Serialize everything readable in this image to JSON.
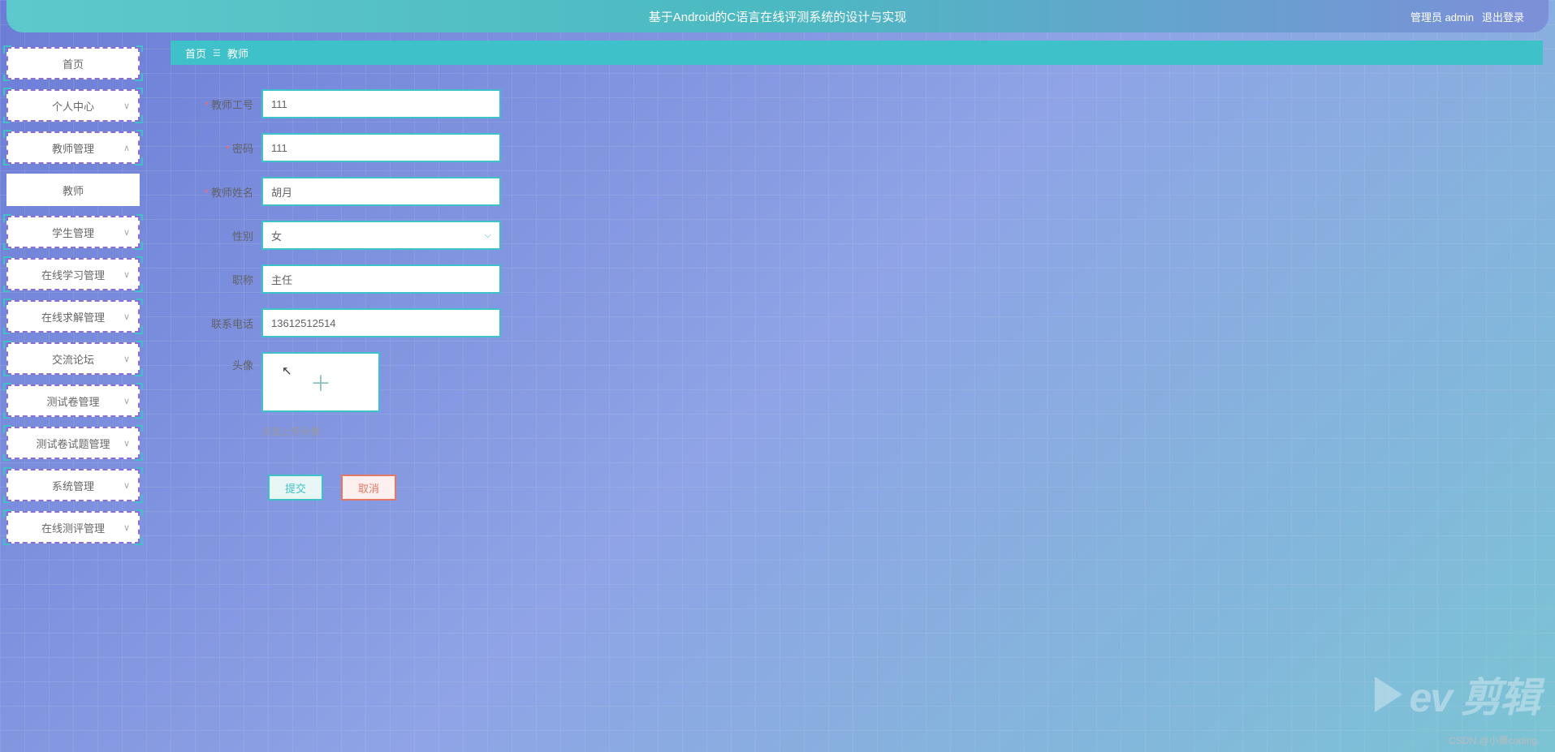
{
  "header": {
    "title": "基于Android的C语言在线评测系统的设计与实现",
    "admin_label": "管理员 admin",
    "logout": "退出登录"
  },
  "sidebar": {
    "items": [
      {
        "label": "首页",
        "arrow": ""
      },
      {
        "label": "个人中心",
        "arrow": "∨"
      },
      {
        "label": "教师管理",
        "arrow": "∧"
      },
      {
        "label": "教师",
        "arrow": "",
        "plain": true
      },
      {
        "label": "学生管理",
        "arrow": "∨"
      },
      {
        "label": "在线学习管理",
        "arrow": "∨"
      },
      {
        "label": "在线求解管理",
        "arrow": "∨"
      },
      {
        "label": "交流论坛",
        "arrow": "∨"
      },
      {
        "label": "测试卷管理",
        "arrow": "∨"
      },
      {
        "label": "测试卷试题管理",
        "arrow": "∨"
      },
      {
        "label": "系统管理",
        "arrow": "∨"
      },
      {
        "label": "在线测评管理",
        "arrow": "∨"
      }
    ]
  },
  "breadcrumb": {
    "home": "首页",
    "current": "教师"
  },
  "form": {
    "fields": {
      "teacher_id": {
        "label": "教师工号",
        "value": "111",
        "required": true
      },
      "password": {
        "label": "密码",
        "value": "111",
        "required": true
      },
      "name": {
        "label": "教师姓名",
        "value": "胡月",
        "required": true
      },
      "gender": {
        "label": "性别",
        "value": "女"
      },
      "title": {
        "label": "职称",
        "value": "主任"
      },
      "phone": {
        "label": "联系电话",
        "value": "13612512514"
      },
      "avatar": {
        "label": "头像",
        "hint": "点击上传头像"
      }
    },
    "buttons": {
      "submit": "提交",
      "cancel": "取消"
    }
  },
  "watermark": {
    "text": "ev 剪辑",
    "csdn": "CSDN @小蔡coding"
  }
}
